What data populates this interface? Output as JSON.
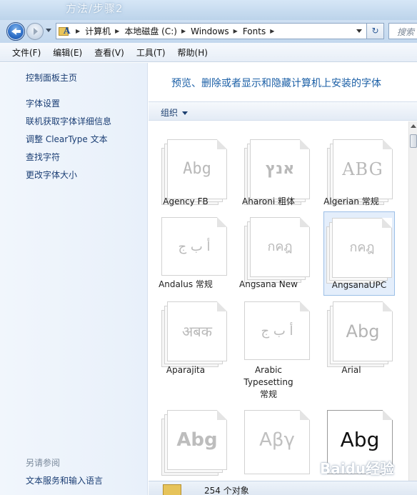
{
  "window": {
    "title": "方法/步骤2"
  },
  "address": {
    "crumbs": [
      "计算机",
      "本地磁盘 (C:)",
      "Windows",
      "Fonts"
    ],
    "search_placeholder": "搜索"
  },
  "menu": [
    "文件(F)",
    "编辑(E)",
    "查看(V)",
    "工具(T)",
    "帮助(H)"
  ],
  "sidebar": {
    "home": "控制面板主页",
    "links": [
      "字体设置",
      "联机获取字体详细信息",
      "调整 ClearType 文本",
      "查找字符",
      "更改字体大小"
    ],
    "see_also_label": "另请参阅",
    "see_also": [
      "文本服务和输入语言"
    ]
  },
  "main": {
    "heading": "预览、删除或者显示和隐藏计算机上安装的字体",
    "organize_label": "组织"
  },
  "fonts": [
    {
      "name": "Agency FB",
      "sample": "Abg"
    },
    {
      "name": "Aharoni 粗体",
      "sample": "אנץ"
    },
    {
      "name": "Algerian 常规",
      "sample": "ABG"
    },
    {
      "name": "Andalus 常规",
      "sample": "أ ب ج"
    },
    {
      "name": "Angsana New",
      "sample": "กคฎ"
    },
    {
      "name": "AngsanaUPC",
      "sample": "กคฎ"
    },
    {
      "name": "Aparajita",
      "sample": "अबक"
    },
    {
      "name": "Arabic Typesetting 常规",
      "sample": "أ ب ج"
    },
    {
      "name": "Arial",
      "sample": "Abg"
    },
    {
      "name": "",
      "sample": "Abg"
    },
    {
      "name": "",
      "sample": "Αβγ"
    },
    {
      "name": "",
      "sample": "Abg"
    }
  ],
  "status": {
    "count_text": "254 个对象"
  },
  "watermark": "Baidu经验"
}
